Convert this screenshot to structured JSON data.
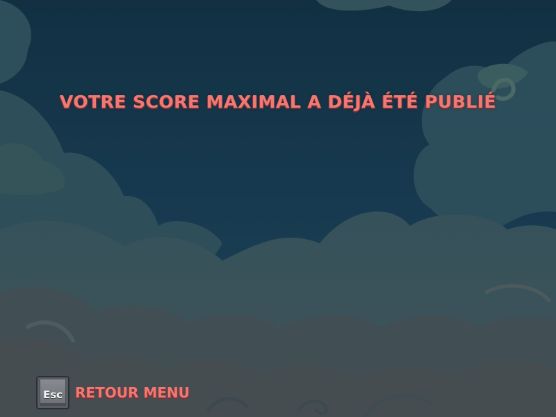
{
  "screen": {
    "message": "VOTRE SCORE MAXIMAL A DÉJÀ ÉTÉ PUBLIÉ",
    "background_color": "#15344a",
    "text_color": "#f07a73"
  },
  "controls": {
    "back": {
      "key": "Esc",
      "label": "RETOUR MENU",
      "icon": "esc-key-icon"
    }
  }
}
